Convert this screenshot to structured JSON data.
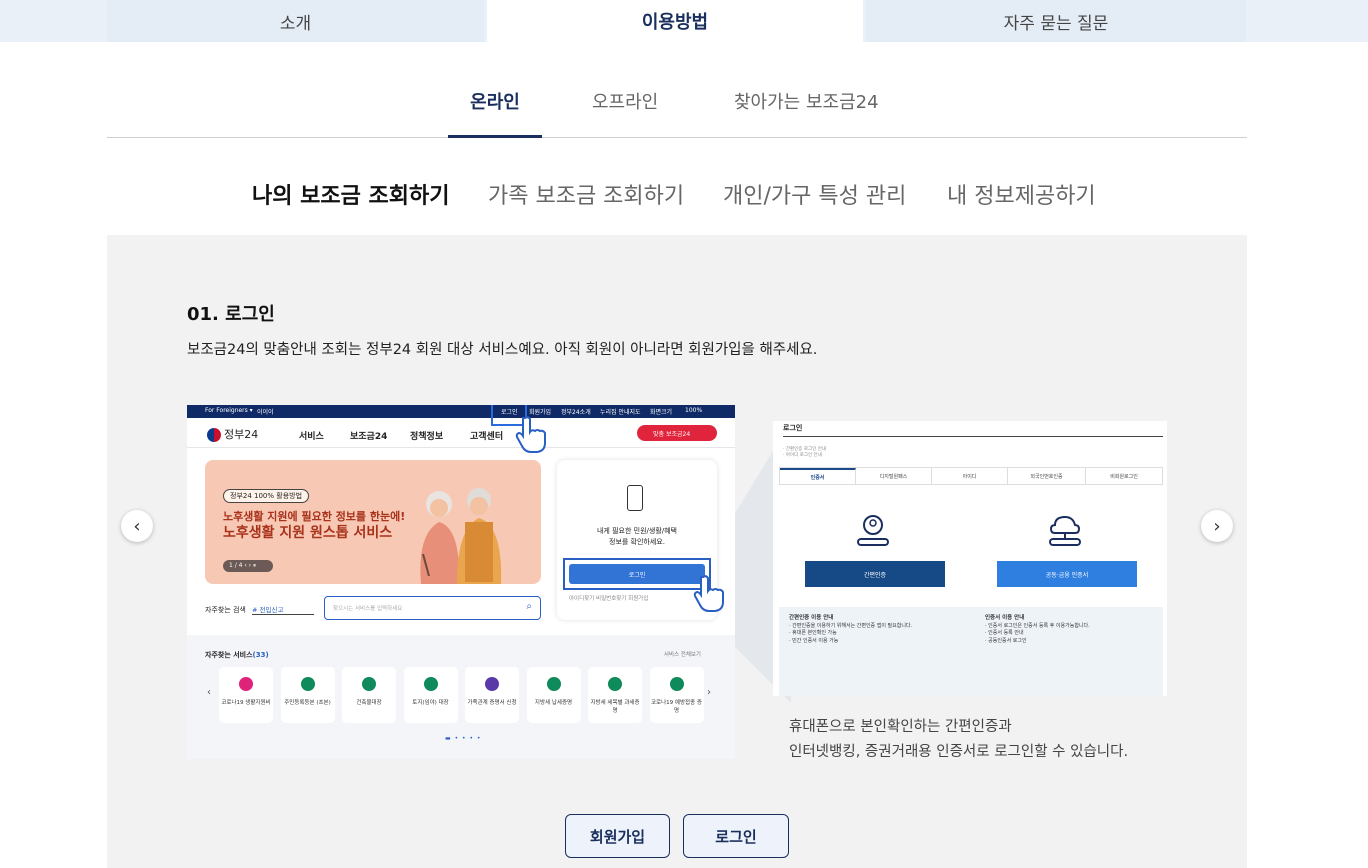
{
  "top_tabs": [
    "소개",
    "이용방법",
    "자주 묻는 질문"
  ],
  "method_tabs": [
    "온라인",
    "오프라인",
    "찾아가는 보조금24"
  ],
  "sub_tabs": [
    "나의 보조금 조회하기",
    "가족 보조금 조회하기",
    "개인/가구 특성 관리",
    "내 정보제공하기"
  ],
  "step": {
    "title": "01. 로그인",
    "description": "보조금24의 맞춤안내 조회는 정부24 회원 대상 서비스예요. 아직 회원이 아니라면 회원가입을 해주세요."
  },
  "carousel": {
    "prev": "‹",
    "next": "›"
  },
  "shot1": {
    "top_bar_left": "For Foreigners ▾",
    "top_bar_lang": "이이이",
    "top_bar_items": [
      "로그인",
      "회원가입",
      "정부24소개",
      "누리집 안내지도",
      "화면크기"
    ],
    "zoom": "100%",
    "logo": "정부24",
    "nav": [
      "서비스",
      "보조금24",
      "정책정보",
      "고객센터"
    ],
    "pill": "맞춤 보조금24",
    "banner_tag": "정부24 100% 활용방법",
    "banner_line1": "노후생활 지원에 필요한 정보를 한눈에!",
    "banner_line2": "노후생활 지원 원스톱 서비스",
    "banner_page": "1 / 4  ‹  ›  ⏸",
    "card_text1": "내게 필요한 민원/생활/혜택",
    "card_text2": "정보를 확인하세요.",
    "card_btn": "로그인",
    "card_links": "아이디찾기    비밀번호찾기                         회원가입",
    "search_label": "자주찾는 검색",
    "search_select": "# 전입신고",
    "search_placeholder": "찾으시는 서비스를 입력하세요",
    "freq_title": "자주찾는 서비스",
    "freq_count": "(33)",
    "freq_all": "서비스 전체보기",
    "freq_items": [
      {
        "label": "코로나19 생활지원비",
        "color": "#e0237a"
      },
      {
        "label": "주민등록등본 (초본)",
        "color": "#0f8a5a"
      },
      {
        "label": "건축물대장",
        "color": "#0f8a5a"
      },
      {
        "label": "토지(임야) 대장",
        "color": "#0f8a5a"
      },
      {
        "label": "가족관계 증명서 신청",
        "color": "#5a3aa8"
      },
      {
        "label": "지방세 납세증명",
        "color": "#0f8a5a"
      },
      {
        "label": "지방세 세목별 과세증명",
        "color": "#0f8a5a"
      },
      {
        "label": "코로나19 예방접종 증명",
        "color": "#0f8a5a"
      }
    ]
  },
  "shot2": {
    "title": "로그인",
    "small_text": "· 간편인증 로그인 안내\n· 아이디 로그인 안내",
    "tabs": [
      "인증서",
      "디지털원패스",
      "아이디",
      "외국인번호인증",
      "비회원로그인"
    ],
    "left_btn": "간편인증",
    "right_btn": "공동·금융 인증서",
    "info_left_title": "간편인증 이용 안내",
    "info_left": "· 간편인증을 이용하기 위해서는 간편인증 앱이 필요합니다.\n· 휴대폰 본인확인 가능\n· 민간 인증서 이용 가능",
    "info_right_title": "인증서 이용 안내",
    "info_right": "· 인증서 로그인은 인증서 등록 후 이용가능합니다.\n· 인증서 등록 안내\n· 공동인증서 로그인"
  },
  "caption_line1": "휴대폰으로 본인확인하는 간편인증과",
  "caption_line2": "인터넷뱅킹, 증권거래용 인증서로 로그인할 수 있습니다.",
  "buttons": {
    "signup": "회원가입",
    "login": "로그인"
  },
  "colors": {
    "navy": "#1a2f5e",
    "blue": "#2a5fc4",
    "panel": "#f2f2f2",
    "red": "#e0243c"
  }
}
